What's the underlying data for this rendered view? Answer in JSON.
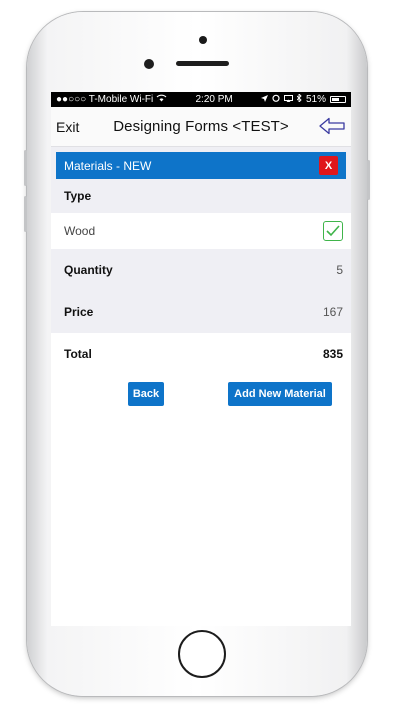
{
  "status_bar": {
    "carrier": "●●○○○ T-Mobile Wi-Fi",
    "time": "2:20 PM",
    "battery": "51%"
  },
  "nav": {
    "exit_label": "Exit",
    "title": "Designing Forms <TEST>"
  },
  "section": {
    "title": "Materials - NEW",
    "close_label": "X"
  },
  "form": {
    "type_label": "Type",
    "type_value": "Wood",
    "quantity_label": "Quantity",
    "quantity_value": "5",
    "price_label": "Price",
    "price_value": "167",
    "total_label": "Total",
    "total_value": "835"
  },
  "actions": {
    "back_label": "Back",
    "add_label": "Add New Material"
  },
  "colors": {
    "accent": "#0e74c9",
    "danger": "#e0161b",
    "check": "#3fb44a",
    "nav_arrow": "#3a3aa0"
  }
}
